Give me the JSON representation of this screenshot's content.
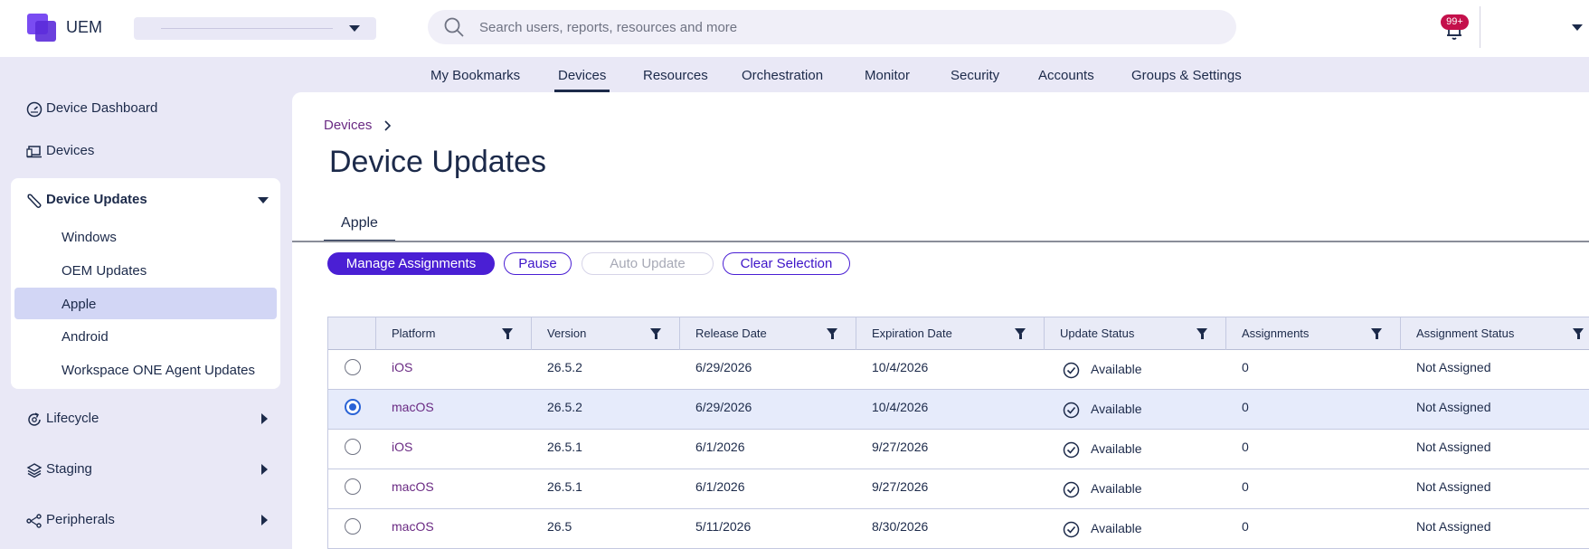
{
  "header": {
    "app_name": "UEM",
    "search_placeholder": "Search users, reports, resources and more",
    "notification_badge": "99+"
  },
  "main_nav": {
    "tabs": [
      {
        "label": "My Bookmarks"
      },
      {
        "label": "Devices",
        "active": true
      },
      {
        "label": "Resources"
      },
      {
        "label": "Orchestration"
      },
      {
        "label": "Monitor"
      },
      {
        "label": "Security"
      },
      {
        "label": "Accounts"
      },
      {
        "label": "Groups & Settings"
      }
    ]
  },
  "sidebar": {
    "items": [
      {
        "label": "Device Dashboard",
        "icon": "dashboard-icon"
      },
      {
        "label": "Devices",
        "icon": "devices-icon"
      },
      {
        "label": "Device Updates",
        "icon": "wrench-icon",
        "expanded": true,
        "children": [
          {
            "label": "Windows"
          },
          {
            "label": "OEM Updates"
          },
          {
            "label": "Apple",
            "selected": true
          },
          {
            "label": "Android"
          },
          {
            "label": "Workspace ONE Agent Updates"
          }
        ]
      },
      {
        "label": "Lifecycle",
        "icon": "lifecycle-icon"
      },
      {
        "label": "Staging",
        "icon": "layers-icon"
      },
      {
        "label": "Peripherals",
        "icon": "peripherals-icon"
      }
    ]
  },
  "page": {
    "breadcrumb": "Devices",
    "title": "Device Updates",
    "subtab": "Apple"
  },
  "actions": {
    "manage_assignments": "Manage Assignments",
    "pause": "Pause",
    "auto_update": "Auto Update",
    "clear_selection": "Clear Selection"
  },
  "table": {
    "columns": [
      "Platform",
      "Version",
      "Release Date",
      "Expiration Date",
      "Update Status",
      "Assignments",
      "Assignment Status"
    ],
    "rows": [
      {
        "selected": false,
        "platform": "iOS",
        "version": "26.5.2",
        "release_date": "6/29/2026",
        "expiration_date": "10/4/2026",
        "update_status": "Available",
        "assignments": "0",
        "assignment_status": "Not Assigned"
      },
      {
        "selected": true,
        "platform": "macOS",
        "version": "26.5.2",
        "release_date": "6/29/2026",
        "expiration_date": "10/4/2026",
        "update_status": "Available",
        "assignments": "0",
        "assignment_status": "Not Assigned"
      },
      {
        "selected": false,
        "platform": "iOS",
        "version": "26.5.1",
        "release_date": "6/1/2026",
        "expiration_date": "9/27/2026",
        "update_status": "Available",
        "assignments": "0",
        "assignment_status": "Not Assigned"
      },
      {
        "selected": false,
        "platform": "macOS",
        "version": "26.5.1",
        "release_date": "6/1/2026",
        "expiration_date": "9/27/2026",
        "update_status": "Available",
        "assignments": "0",
        "assignment_status": "Not Assigned"
      },
      {
        "selected": false,
        "platform": "macOS",
        "version": "26.5",
        "release_date": "5/11/2026",
        "expiration_date": "8/30/2026",
        "update_status": "Available",
        "assignments": "0",
        "assignment_status": "Not Assigned"
      }
    ]
  },
  "colors": {
    "brand": "#5b2bd9",
    "primary_button": "#4a1fd4",
    "link_purple": "#6a2a83",
    "selected_row": "#e6ebfb",
    "badge": "#c4104b"
  }
}
